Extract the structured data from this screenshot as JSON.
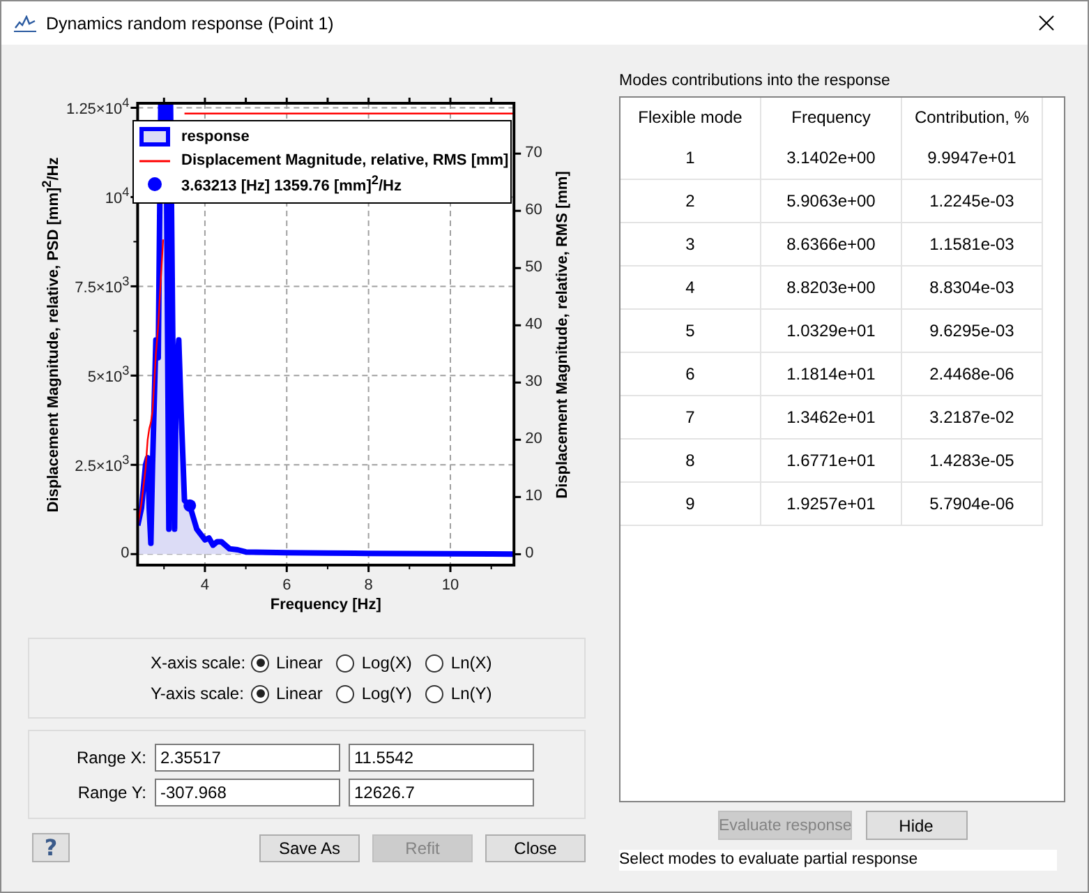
{
  "window": {
    "title": "Dynamics random response  (Point 1)"
  },
  "chart": {
    "chart_data": {
      "type": "line",
      "grid": true,
      "legend": "top",
      "y2label": "Displacement Magnitude, relative, RMS [mm]",
      "y2lim": [
        -1.9,
        78.8
      ],
      "y2ticks": [
        0,
        10,
        20,
        30,
        40,
        50,
        60,
        70
      ],
      "xlabel": "Frequency [Hz]",
      "ylabel": "Displacement Magnitude, relative, PSD [mm]$^{2}$/Hz",
      "xlim": [
        2.35517,
        11.5542
      ],
      "ylim": [
        -307.968,
        12626.7
      ],
      "xticks": [
        4,
        6,
        8,
        10
      ],
      "yticks": [
        {
          "value": 0,
          "label": "0"
        },
        {
          "value": 2500,
          "label": "2.5×10$^{3}$"
        },
        {
          "value": 5000,
          "label": "5×10$^{3}$"
        },
        {
          "value": 7500,
          "label": "7.5×10$^{3}$"
        },
        {
          "value": 10000,
          "label": "10$^{4}$"
        },
        {
          "value": 12500,
          "label": "1.25×10$^{4}$"
        }
      ],
      "x": [
        2.36,
        2.45,
        2.55,
        2.6,
        2.64,
        2.68,
        2.72,
        2.8,
        2.86,
        2.92,
        2.98,
        3.05,
        3.12,
        3.16,
        3.26,
        3.3,
        3.36,
        3.42,
        3.5,
        3.63,
        3.8,
        4.0,
        4.1,
        4.2,
        4.3,
        4.4,
        4.6,
        4.8,
        5.0,
        6,
        7,
        8,
        9,
        10,
        11,
        11.55
      ],
      "series": [
        {
          "name": "response",
          "type": "area",
          "color": "#0000ff",
          "values": [
            800,
            1300,
            2500,
            2700,
            1200,
            300,
            2500,
            6000,
            5500,
            12600,
            12600,
            12600,
            700,
            12600,
            700,
            5000,
            6000,
            4000,
            1500,
            1360,
            700,
            400,
            450,
            250,
            350,
            350,
            150,
            120,
            60,
            40,
            30,
            20,
            15,
            10,
            5,
            0
          ]
        },
        {
          "name": "Displacement Magnitude, relative, RMS [mm]",
          "type": "line",
          "color": "#ff0000",
          "axis": "y2",
          "values": [
            5,
            9,
            15,
            20,
            22,
            23,
            25,
            35,
            40,
            48,
            55,
            null,
            null,
            null,
            null,
            null,
            null,
            null,
            77,
            77,
            77,
            77,
            77,
            77,
            77,
            77,
            77,
            77,
            77,
            77,
            77,
            77,
            77,
            77,
            77,
            77
          ]
        },
        {
          "name": "3.63213 [Hz] 1359.76 [mm]$^{2}$/Hz",
          "type": "scatter",
          "color": "#0000ff",
          "values": [
            null,
            null,
            null,
            null,
            null,
            null,
            null,
            null,
            null,
            null,
            null,
            null,
            null,
            null,
            null,
            null,
            null,
            null,
            null,
            1360,
            null,
            null,
            null,
            null,
            null,
            null,
            null,
            null,
            null,
            null,
            null,
            null,
            null,
            null,
            null,
            null
          ]
        }
      ]
    }
  },
  "scales": [
    {
      "label": "X-axis scale:",
      "options": [
        {
          "label": "Linear",
          "selected": true
        },
        {
          "label": "Log(X)",
          "selected": false
        },
        {
          "label": "Ln(X)",
          "selected": false
        }
      ]
    },
    {
      "label": "Y-axis scale:",
      "options": [
        {
          "label": "Linear",
          "selected": true
        },
        {
          "label": "Log(Y)",
          "selected": false
        },
        {
          "label": "Ln(Y)",
          "selected": false
        }
      ]
    }
  ],
  "ranges": [
    {
      "label": "Range X:",
      "from": "2.35517",
      "to": "11.5542"
    },
    {
      "label": "Range Y:",
      "from": "-307.968",
      "to": "12626.7"
    }
  ],
  "help": "?",
  "buttons": [
    {
      "label": "Save As",
      "disabled": false
    },
    {
      "label": "Refit",
      "disabled": true
    },
    {
      "label": "Close",
      "disabled": false
    }
  ],
  "modes": {
    "title": "Modes contributions into the response",
    "columns": [
      "Flexible mode",
      "Frequency",
      "Contribution, %"
    ],
    "rows": [
      [
        "1",
        "3.1402e+00",
        "9.9947e+01"
      ],
      [
        "2",
        "5.9063e+00",
        "1.2245e-03"
      ],
      [
        "3",
        "8.6366e+00",
        "1.1581e-03"
      ],
      [
        "4",
        "8.8203e+00",
        "8.8304e-03"
      ],
      [
        "5",
        "1.0329e+01",
        "9.6295e-03"
      ],
      [
        "6",
        "1.1814e+01",
        "2.4468e-06"
      ],
      [
        "7",
        "1.3462e+01",
        "3.2187e-02"
      ],
      [
        "8",
        "1.6771e+01",
        "1.4283e-05"
      ],
      [
        "9",
        "1.9257e+01",
        "5.7904e-06"
      ]
    ],
    "buttons": [
      {
        "label": "Evaluate response",
        "disabled": true
      },
      {
        "label": "Hide",
        "disabled": false
      }
    ],
    "status": "Select modes to evaluate partial response"
  }
}
